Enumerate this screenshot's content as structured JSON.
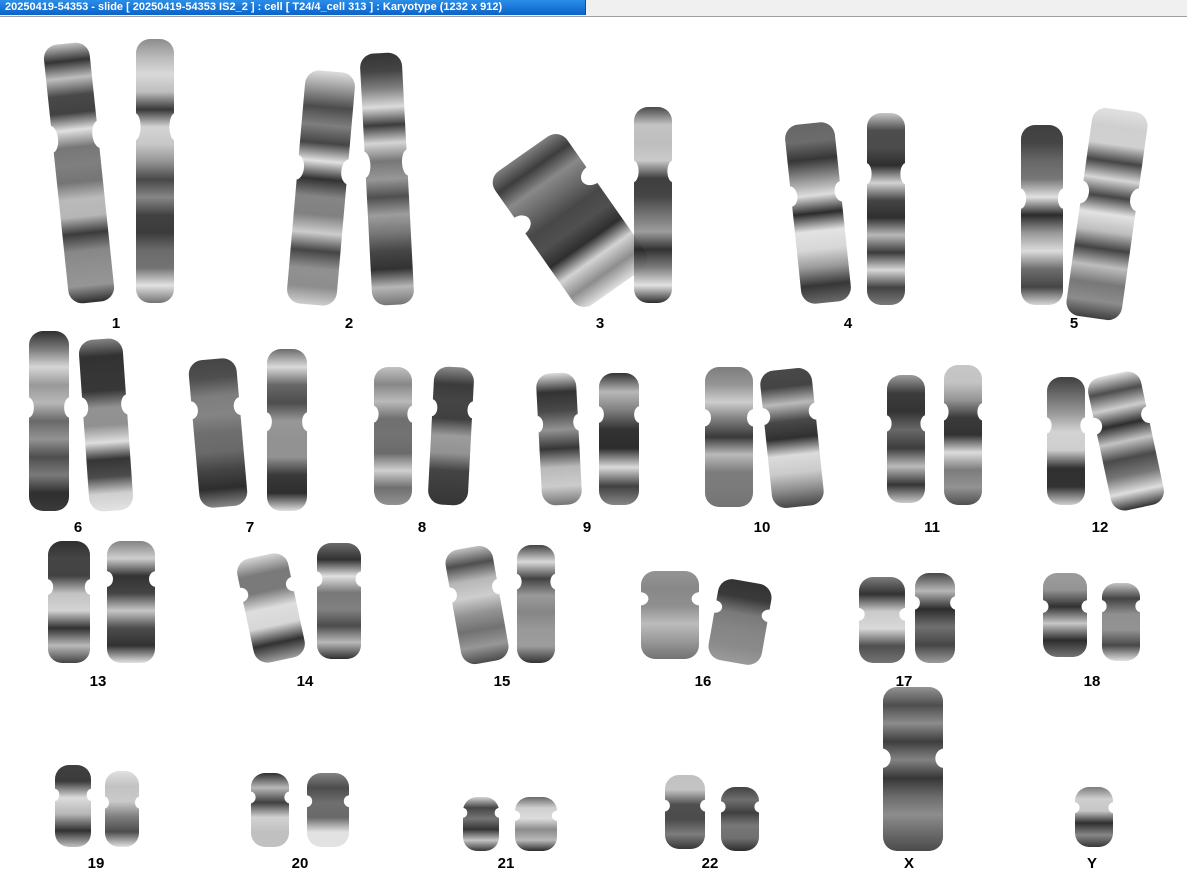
{
  "window": {
    "title": "20250419-54353 - slide [ 20250419-54353 IS2_2 ] : cell [ T24/4_cell 313 ] : Karyotype  (1232 x 912)"
  },
  "karyotype": {
    "labels": [
      "1",
      "2",
      "3",
      "4",
      "5",
      "6",
      "7",
      "8",
      "9",
      "10",
      "11",
      "12",
      "13",
      "14",
      "15",
      "16",
      "17",
      "18",
      "19",
      "20",
      "21",
      "22",
      "X",
      "Y"
    ]
  },
  "colors": {
    "title_bar": "#1476d8",
    "chromosome_dark": "#1a1a1a",
    "chromosome_light": "#cfcfcf",
    "background": "#ffffff"
  }
}
